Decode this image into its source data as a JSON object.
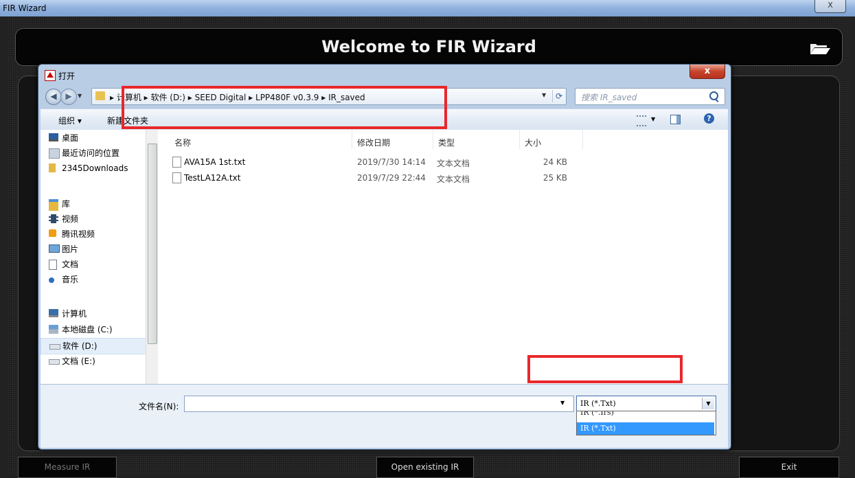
{
  "outer": {
    "title": "FIR Wizard",
    "close_label": "X"
  },
  "app": {
    "banner_title": "Welcome to FIR Wizard",
    "buttons": {
      "measure": "Measure IR",
      "open": "Open existing IR",
      "exit": "Exit"
    }
  },
  "dialog": {
    "title": "打开",
    "close_label": "x",
    "address_crumbs": "▸ 计算机 ▸ 软件 (D:) ▸ SEED Digital ▸ LPP480F v0.3.9 ▸ IR_saved",
    "search_placeholder": "搜索 IR_saved",
    "toolbar": {
      "organize": "组织 ▾",
      "new_folder": "新建文件夹"
    },
    "nav_items": [
      {
        "label": "桌面",
        "icon": "desktop-icon"
      },
      {
        "label": "最近访问的位置",
        "icon": "recent-places-icon"
      },
      {
        "label": "2345Downloads",
        "icon": "folder-icon"
      },
      {
        "label": "库",
        "icon": "library-icon"
      },
      {
        "label": "视频",
        "icon": "video-icon"
      },
      {
        "label": "腾讯视频",
        "icon": "tencent-video-icon"
      },
      {
        "label": "图片",
        "icon": "pictures-icon"
      },
      {
        "label": "文档",
        "icon": "documents-icon"
      },
      {
        "label": "音乐",
        "icon": "music-icon"
      },
      {
        "label": "计算机",
        "icon": "computer-icon"
      },
      {
        "label": "本地磁盘 (C:)",
        "icon": "drive-c-icon"
      },
      {
        "label": "软件 (D:)",
        "icon": "drive-d-icon"
      },
      {
        "label": "文档 (E:)",
        "icon": "drive-e-icon"
      }
    ],
    "columns": {
      "name": "名称",
      "date": "修改日期",
      "type": "类型",
      "size": "大小"
    },
    "files": [
      {
        "name": "AVA15A 1st.txt",
        "date": "2019/7/30 14:14",
        "type": "文本文档",
        "size": "24 KB"
      },
      {
        "name": "TestLA12A.txt",
        "date": "2019/7/29 22:44",
        "type": "文本文档",
        "size": "25 KB"
      }
    ],
    "filename_label": "文件名(N):",
    "filename_value": "",
    "filetype_selected": "IR (*.Txt)",
    "filetype_options": [
      "IR (*.Irs)",
      "IR (*.Txt)"
    ],
    "highlight_color": "#e8272b",
    "selection_color": "#3399ff"
  }
}
